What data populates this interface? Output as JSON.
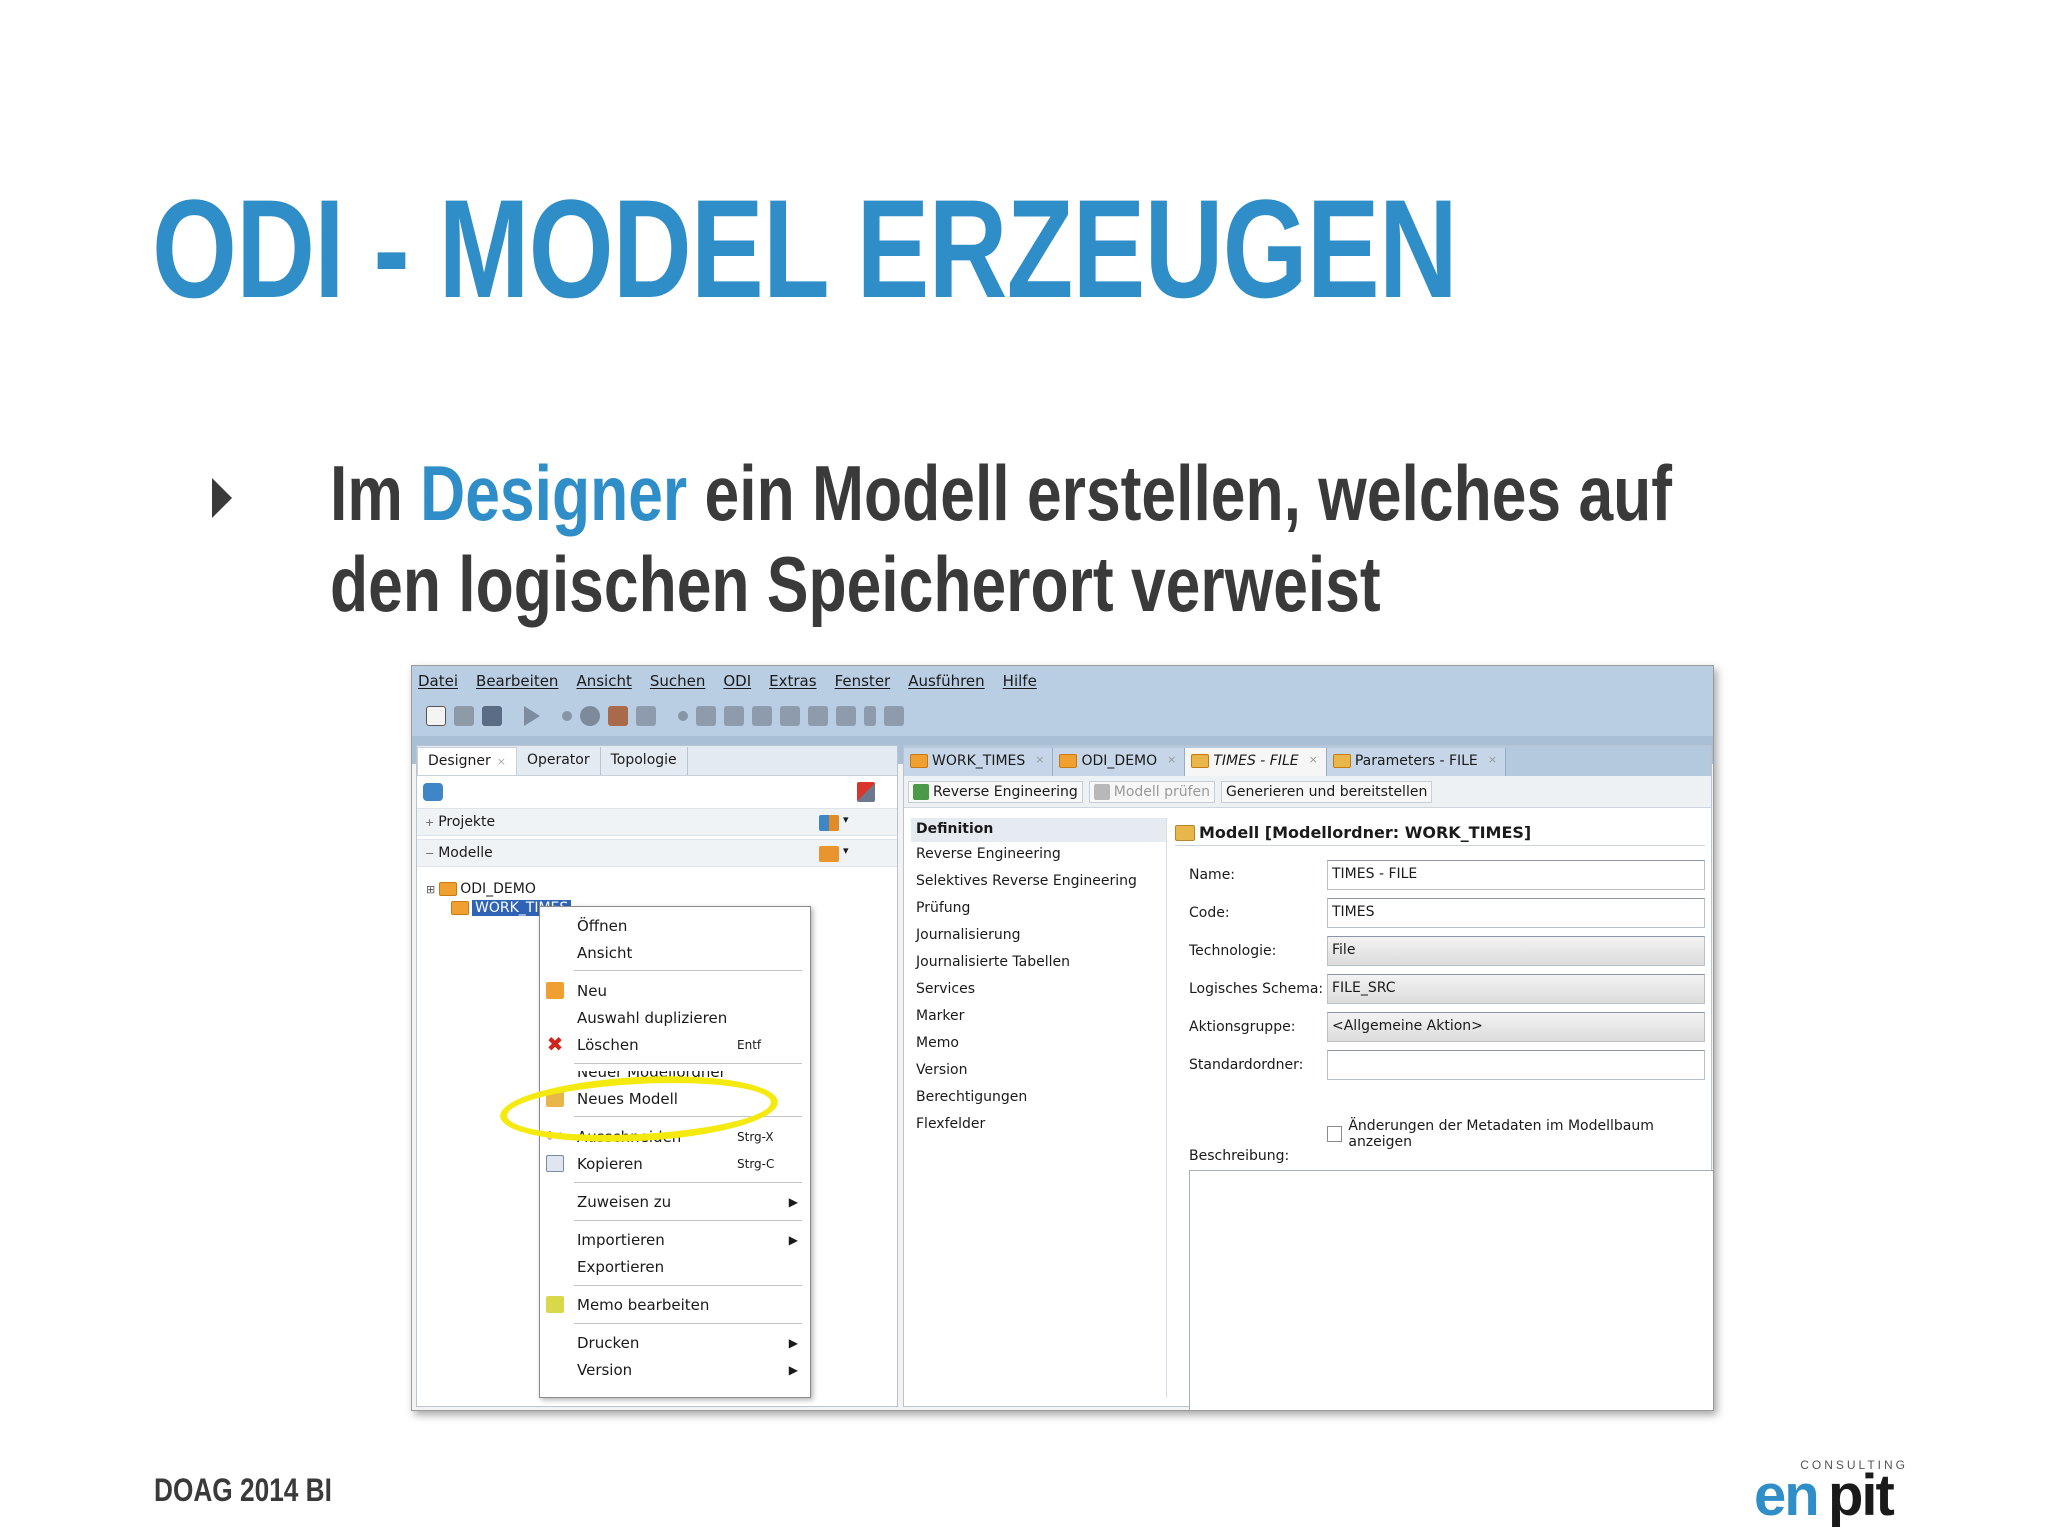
{
  "slide": {
    "title": "ODI - MODEL ERZEUGEN",
    "bullet_pre": "Im ",
    "bullet_highlight": "Designer",
    "bullet_post": " ein Modell erstellen, welches auf den logischen Speicherort verweist",
    "footer": "DOAG 2014 BI",
    "logo_top": "CONSULTING",
    "logo_en": "en",
    "logo_pit": "pit"
  },
  "colors": {
    "accent": "#2f8ec8",
    "text": "#3a3a3a",
    "highlight": "#f5ea10",
    "menubar": "#b9cde3"
  },
  "menu": [
    "Datei",
    "Bearbeiten",
    "Ansicht",
    "Suchen",
    "ODI",
    "Extras",
    "Fenster",
    "Ausführen",
    "Hilfe"
  ],
  "left_tabs": [
    {
      "label": "Designer",
      "close": "×"
    },
    {
      "label": "Operator"
    },
    {
      "label": "Topologie"
    }
  ],
  "sections": {
    "projects": "Projekte",
    "models": "Modelle",
    "expand": "+",
    "collapse": "−",
    "dropdown": "▾"
  },
  "tree": {
    "odi_demo": "ODI_DEMO",
    "work_times": "WORK_TIMES",
    "expander": "⊞"
  },
  "context_menu": {
    "open": "Öffnen",
    "view": "Ansicht",
    "new": "Neu",
    "duplicate": "Auswahl duplizieren",
    "delete": "Löschen",
    "delete_acc": "Entf",
    "new_folder": "Neuer Modellordner",
    "new_model": "Neues Modell",
    "cut": "Ausschneiden",
    "cut_acc": "Strg-X",
    "copy": "Kopieren",
    "copy_acc": "Strg-C",
    "assign": "Zuweisen zu",
    "import": "Importieren",
    "export": "Exportieren",
    "memo": "Memo bearbeiten",
    "print": "Drucken",
    "version": "Version",
    "submenu_arrow": "▶"
  },
  "editor_tabs": [
    {
      "label": "WORK_TIMES",
      "close": "×"
    },
    {
      "label": "ODI_DEMO",
      "close": "×"
    },
    {
      "label": "TIMES - FILE",
      "close": "×"
    },
    {
      "label": "Parameters - FILE",
      "close": "×"
    }
  ],
  "editor_toolbar": {
    "reverse": "Reverse Engineering",
    "check": "Modell prüfen",
    "generate": "Generieren und bereitstellen"
  },
  "nav": {
    "header": "Definition",
    "items": [
      "Reverse Engineering",
      "Selektives Reverse Engineering",
      "Prüfung",
      "Journalisierung",
      "Journalisierte Tabellen",
      "Services",
      "Marker",
      "Memo",
      "Version",
      "Berechtigungen",
      "Flexfelder"
    ]
  },
  "form": {
    "title": "Modell [Modellordner: WORK_TIMES]",
    "name_label": "Name:",
    "name_value": "TIMES - FILE",
    "code_label": "Code:",
    "code_value": "TIMES",
    "tech_label": "Technologie:",
    "tech_value": "File",
    "schema_label": "Logisches Schema:",
    "schema_value": "FILE_SRC",
    "action_label": "Aktionsgruppe:",
    "action_value": "<Allgemeine Aktion>",
    "folder_label": "Standardordner:",
    "folder_value": "",
    "checkbox_label": "Änderungen der Metadaten im Modellbaum anzeigen",
    "desc_label": "Beschreibung:"
  }
}
